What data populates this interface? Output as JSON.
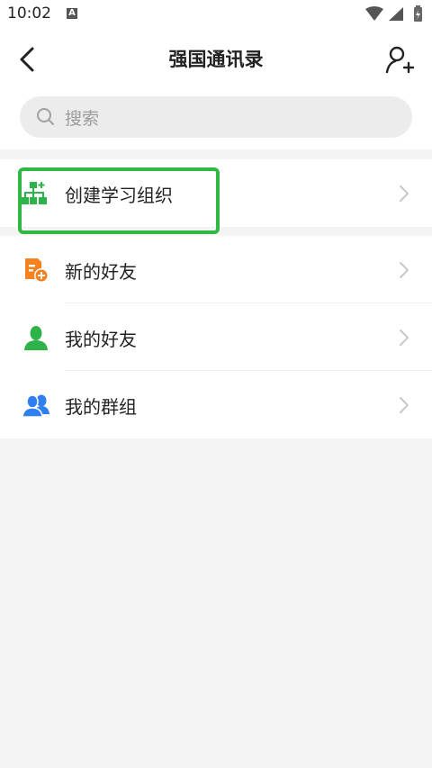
{
  "status_bar": {
    "time": "10:02",
    "notif_letter": "A"
  },
  "header": {
    "title": "强国通讯录"
  },
  "search": {
    "placeholder": "搜索"
  },
  "menu": {
    "create_org": "创建学习组织",
    "new_friends": "新的好友",
    "my_friends": "我的好友",
    "my_groups": "我的群组"
  },
  "colors": {
    "green": "#2db34a",
    "orange": "#f5811f",
    "blue": "#2f7ff0",
    "highlight": "#2fb843"
  }
}
